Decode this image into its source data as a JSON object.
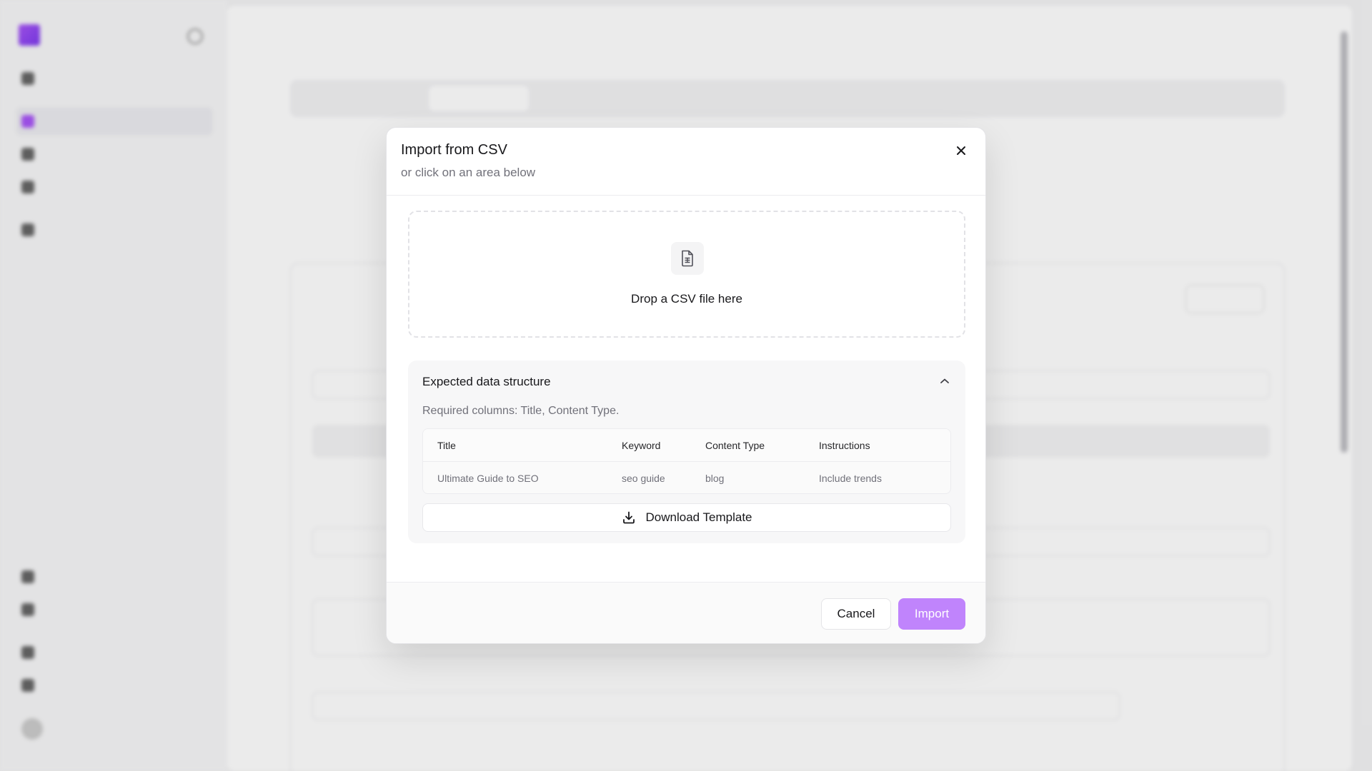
{
  "modal": {
    "title": "Import from CSV",
    "description": "or click on an area below",
    "dropzone_text": "Drop a CSV file here",
    "expected": {
      "title": "Expected data structure",
      "required": "Required columns: Title, Content Type.",
      "columns": [
        "Title",
        "Keyword",
        "Content Type",
        "Instructions"
      ],
      "rows": [
        [
          "Ultimate Guide to SEO",
          "seo guide",
          "blog",
          "Include trends"
        ]
      ]
    },
    "download_label": "Download Template",
    "cancel_label": "Cancel",
    "import_label": "Import",
    "accent_color": "#c084fc"
  },
  "icons": {
    "close": "close-icon",
    "file": "file-spreadsheet-icon",
    "chevron": "chevron-up-icon",
    "download": "download-icon"
  }
}
